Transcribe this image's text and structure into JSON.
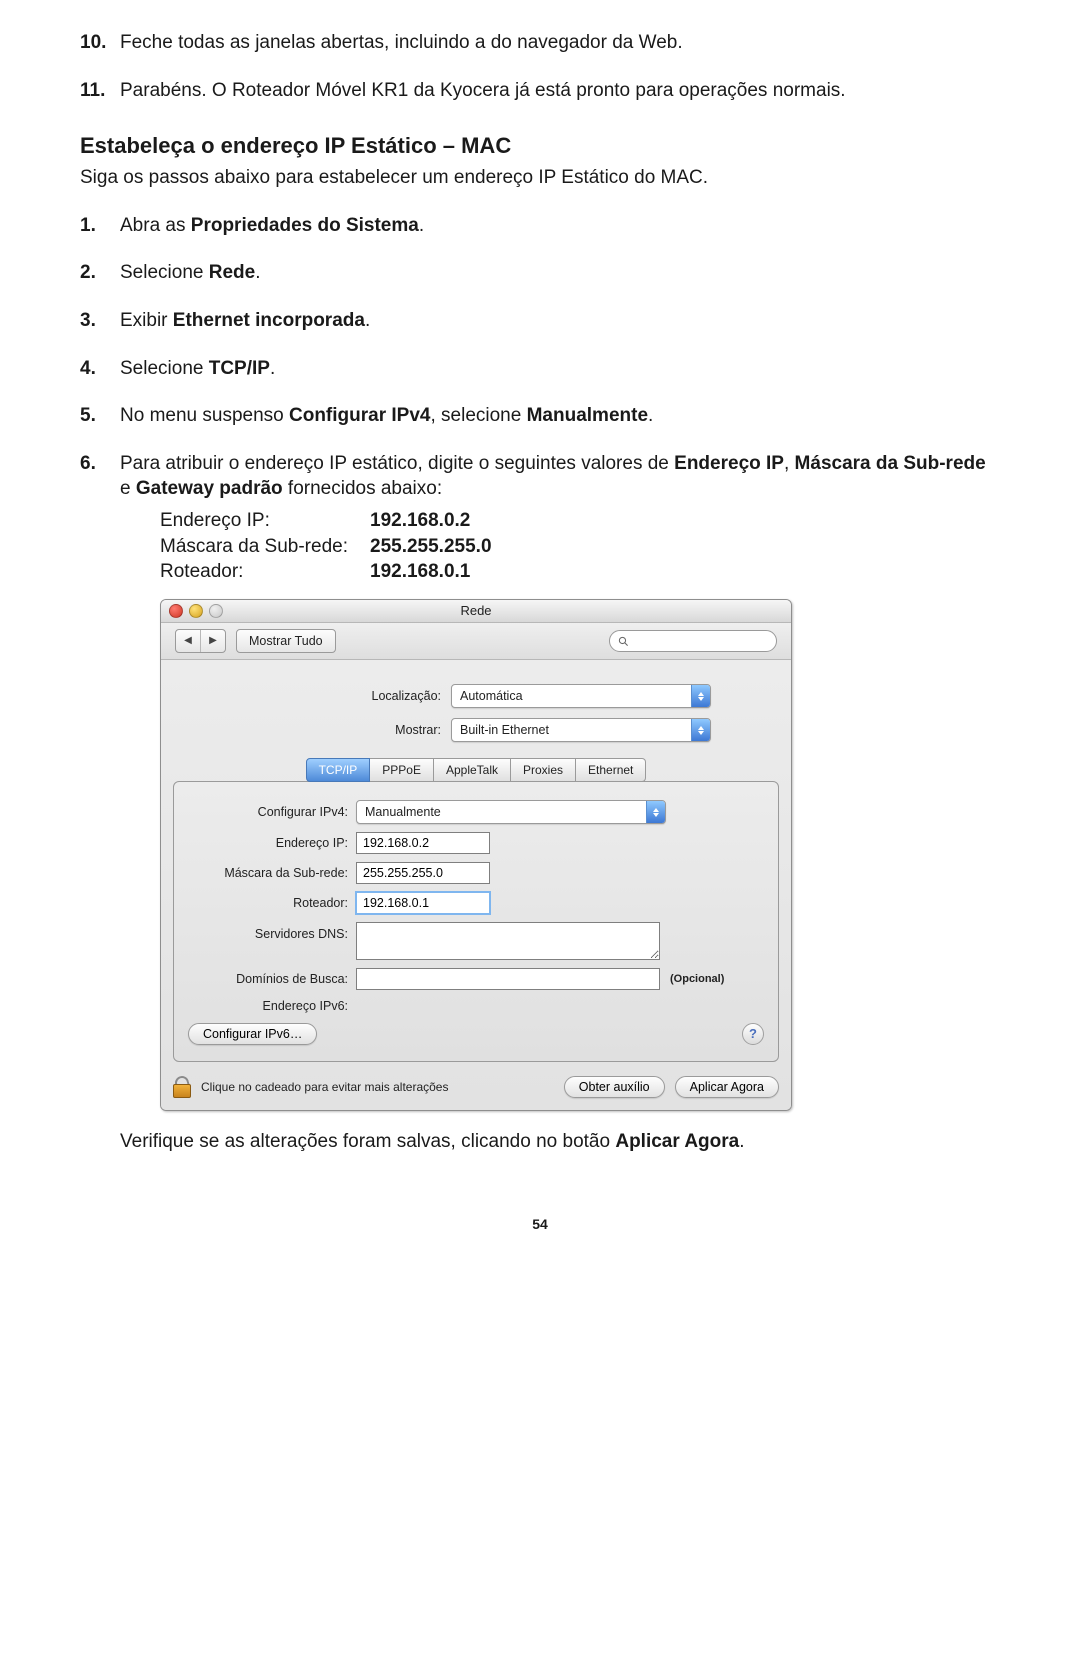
{
  "doc": {
    "prev_steps": [
      {
        "n": "10.",
        "text": "Feche todas as janelas abertas, incluindo a do navegador da Web."
      },
      {
        "n": "11.",
        "text": "Parabéns. O Roteador Móvel KR1 da Kyocera já está pronto para operações normais."
      }
    ],
    "section_title": "Estabeleça o endereço IP Estático – MAC",
    "section_intro": "Siga os passos abaixo para estabelecer um endereço IP Estático do MAC.",
    "steps": {
      "s1": {
        "n": "1.",
        "pre": "Abra as ",
        "bold": "Propriedades do Sistema",
        "post": "."
      },
      "s2": {
        "n": "2.",
        "pre": "Selecione ",
        "bold": "Rede",
        "post": "."
      },
      "s3": {
        "n": "3.",
        "pre": "Exibir ",
        "bold": "Ethernet incorporada",
        "post": "."
      },
      "s4": {
        "n": "4.",
        "pre": "Selecione ",
        "bold": "TCP/IP",
        "post": "."
      },
      "s5": {
        "n": "5.",
        "pre": "No menu suspenso ",
        "b1": "Configurar IPv4",
        "mid": ", selecione ",
        "b2": "Manualmente",
        "post": "."
      },
      "s6": {
        "n": "6.",
        "pre": "Para atribuir o endereço IP estático, digite o seguintes valores de ",
        "b1": "Endereço IP",
        "mid1": ", ",
        "b2": "Máscara da Sub-rede",
        "mid2": " e ",
        "b3": "Gateway padrão",
        "post": " fornecidos abaixo:"
      }
    },
    "ip_table": {
      "r1": {
        "k": "Endereço IP:",
        "v": "192.168.0.2"
      },
      "r2": {
        "k": "Máscara da Sub-rede:",
        "v": "255.255.255.0"
      },
      "r3": {
        "k": "Roteador:",
        "v": "192.168.0.1"
      }
    },
    "verify_pre": "Verifique se as alterações foram salvas, clicando no botão ",
    "verify_bold": "Aplicar Agora",
    "verify_post": ".",
    "page_no": "54"
  },
  "win": {
    "title": "Rede",
    "showall": "Mostrar Tudo",
    "location_label": "Localização:",
    "location_value": "Automática",
    "show_label": "Mostrar:",
    "show_value": "Built-in Ethernet",
    "tabs": [
      "TCP/IP",
      "PPPoE",
      "AppleTalk",
      "Proxies",
      "Ethernet"
    ],
    "active_tab": 0,
    "config_label": "Configurar IPv4:",
    "config_value": "Manualmente",
    "ip_label": "Endereço IP:",
    "ip_value": "192.168.0.2",
    "mask_label": "Máscara da Sub-rede:",
    "mask_value": "255.255.255.0",
    "router_label": "Roteador:",
    "router_value": "192.168.0.1",
    "dns_label": "Servidores DNS:",
    "search_label": "Domínios de Busca:",
    "search_optional": "(Opcional)",
    "ipv6_label": "Endereço IPv6:",
    "ipv6_btn": "Configurar IPv6…",
    "lock_text": "Clique no cadeado para evitar mais alterações",
    "assist_btn": "Obter auxílio",
    "apply_btn": "Aplicar Agora"
  }
}
